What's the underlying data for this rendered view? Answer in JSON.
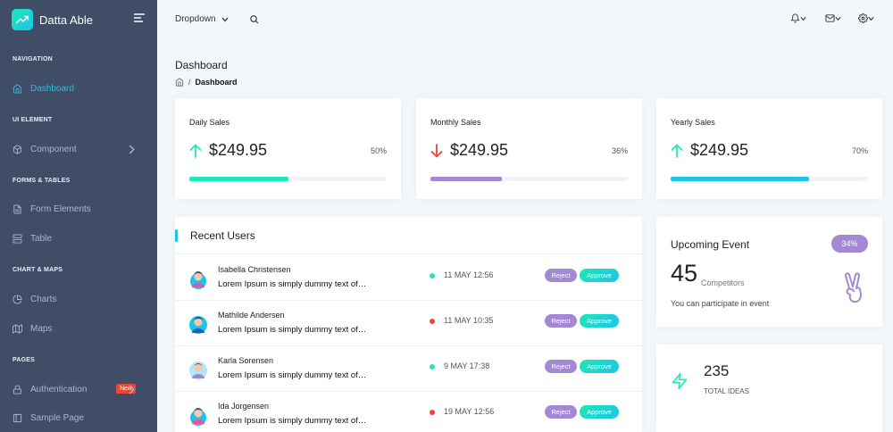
{
  "brand": {
    "name": "Datta Able"
  },
  "sidebar": {
    "captions": [
      "NAVIGATION",
      "UI ELEMENT",
      "FORMS & TABLES",
      "CHART & MAPS",
      "PAGES"
    ],
    "items": [
      {
        "label": "Dashboard",
        "icon": "home-icon",
        "active": true
      },
      {
        "label": "Component",
        "icon": "box-icon",
        "has_submenu": true
      },
      {
        "label": "Form Elements",
        "icon": "file-text-icon"
      },
      {
        "label": "Table",
        "icon": "server-icon"
      },
      {
        "label": "Charts",
        "icon": "pie-chart-icon"
      },
      {
        "label": "Maps",
        "icon": "map-icon"
      },
      {
        "label": "Authentication",
        "icon": "lock-icon",
        "badge": "New",
        "has_submenu": true
      },
      {
        "label": "Sample Page",
        "icon": "sidebar-icon"
      }
    ]
  },
  "topbar": {
    "dropdown_label": "Dropdown",
    "icons": [
      "search-icon",
      "bell-icon",
      "mail-icon",
      "settings-icon"
    ]
  },
  "page": {
    "title": "Dashboard",
    "breadcrumb_current": "Dashboard"
  },
  "stats": [
    {
      "title": "Daily Sales",
      "value": "$249.95",
      "trend": "up",
      "percent_label": "50%",
      "percent": 50,
      "color": "#1de9b6"
    },
    {
      "title": "Monthly Sales",
      "value": "$249.95",
      "trend": "down",
      "percent_label": "36%",
      "percent": 36,
      "color": "#a389d4"
    },
    {
      "title": "Yearly Sales",
      "value": "$249.95",
      "trend": "up",
      "percent_label": "70%",
      "percent": 70,
      "color": "#1dc4e9"
    }
  ],
  "recent_users": {
    "title": "Recent Users",
    "reject_label": "Reject",
    "approve_label": "Approve",
    "rows": [
      {
        "name": "Isabella Christensen",
        "desc": "Lorem Ipsum is simply dummy text of…",
        "date": "11 MAY 12:56",
        "status_color": "#1de9b6"
      },
      {
        "name": "Mathilde Andersen",
        "desc": "Lorem Ipsum is simply dummy text of…",
        "date": "11 MAY 10:35",
        "status_color": "#f44236"
      },
      {
        "name": "Karla Sorensen",
        "desc": "Lorem Ipsum is simply dummy text of…",
        "date": "9 MAY 17:38",
        "status_color": "#1de9b6"
      },
      {
        "name": "Ida Jorgensen",
        "desc": "Lorem Ipsum is simply dummy text of…",
        "date": "19 MAY 12:56",
        "status_color": "#f44236"
      }
    ]
  },
  "upcoming_event": {
    "title": "Upcoming Event",
    "badge": "34%",
    "count": "45",
    "count_label": "Competitors",
    "note": "You can participate in event"
  },
  "ideas": {
    "value": "235",
    "label": "TOTAL IDEAS"
  },
  "colors": {
    "sidebar_bg": "#3f4d67",
    "accent": "#1dc4e9",
    "purple": "#a389d4",
    "red": "#f44236",
    "green": "#1de9b6"
  }
}
